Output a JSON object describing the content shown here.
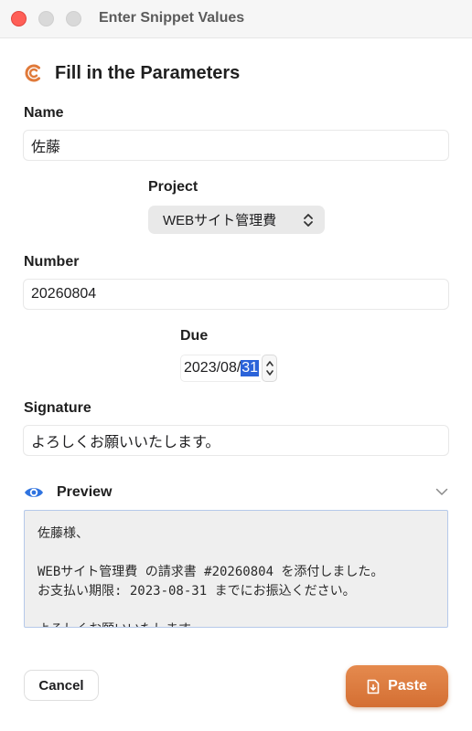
{
  "window": {
    "title": "Enter Snippet Values"
  },
  "header": {
    "title": "Fill in the Parameters",
    "icon": "snippet-app-icon"
  },
  "fields": {
    "name": {
      "label": "Name",
      "value": "佐藤"
    },
    "project": {
      "label": "Project",
      "value": "WEBサイト管理費"
    },
    "number": {
      "label": "Number",
      "value": "20260804"
    },
    "due": {
      "label": "Due",
      "prefix": "2023/08/",
      "day": "31"
    },
    "signature": {
      "label": "Signature",
      "value": "よろしくお願いいたします。"
    }
  },
  "preview": {
    "label": "Preview",
    "lines": [
      "佐藤様、",
      "",
      "WEBサイト管理費 の請求書 #20260804 を添付しました。",
      "お支払い期限: 2023-08-31 までにお振込ください。",
      "",
      "よろしくお願いいたします。"
    ]
  },
  "buttons": {
    "cancel": "Cancel",
    "paste": "Paste"
  },
  "colors": {
    "accent": "#dc7a3c",
    "selection": "#2b63d9",
    "preview_bg": "#efefef"
  }
}
